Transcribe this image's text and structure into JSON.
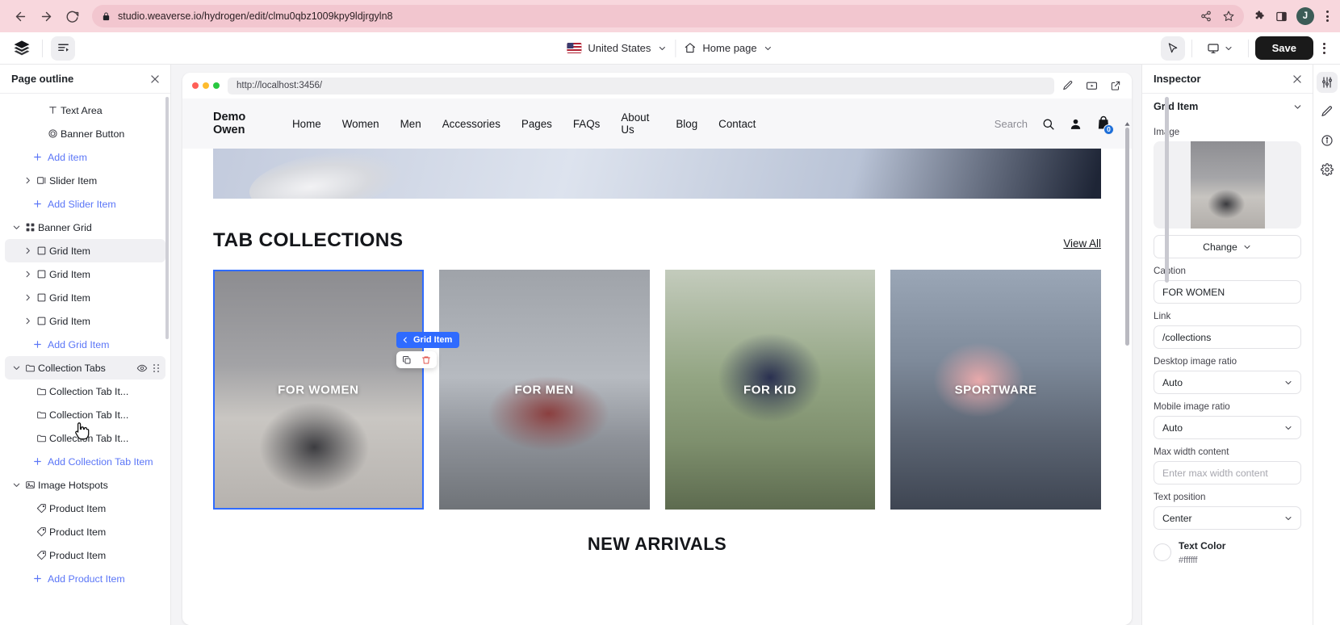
{
  "browser": {
    "url": "studio.weaverse.io/hydrogen/edit/clmu0qbz1009kpy9ldjrgyln8",
    "back_icon": "back-arrow-icon",
    "forward_icon": "forward-arrow-icon",
    "reload_icon": "reload-icon",
    "lock_icon": "lock-icon",
    "share_icon": "share-icon",
    "bookmark_icon": "star-icon",
    "extensions_icon": "puzzle-icon",
    "sidepanel_icon": "side-panel-icon",
    "profile_initial": "J",
    "menu_icon": "kebab-menu-icon"
  },
  "toolbar": {
    "logo_icon": "weaverse-logo-icon",
    "outline_toggle_icon": "page-outline-toggle-icon",
    "market": "United States",
    "page": "Home page",
    "home_icon": "home-icon",
    "chevron_icon": "chevron-down-icon",
    "cursor_tool_icon": "cursor-select-icon",
    "device_icon": "desktop-screen-icon",
    "save_label": "Save",
    "more_icon": "kebab-menu-icon"
  },
  "outline": {
    "title": "Page outline",
    "close_icon": "close-icon",
    "items": [
      {
        "label": "Text Area",
        "icon": "text-icon",
        "indent": 2,
        "caret": "none",
        "type": "item"
      },
      {
        "label": "Banner Button",
        "icon": "circle-target-icon",
        "indent": 2,
        "caret": "none",
        "type": "item"
      },
      {
        "label": "Add item",
        "icon": "plus-icon",
        "indent": 2,
        "caret": "none",
        "type": "add"
      },
      {
        "label": "Slider Item",
        "icon": "slider-item-icon",
        "indent": 1,
        "caret": "right",
        "type": "item"
      },
      {
        "label": "Add Slider Item",
        "icon": "plus-icon",
        "indent": 2,
        "caret": "none",
        "type": "add"
      },
      {
        "label": "Banner Grid",
        "icon": "grid-icon",
        "indent": 0,
        "caret": "down",
        "type": "item"
      },
      {
        "label": "Grid Item",
        "icon": "square-icon",
        "indent": 1,
        "caret": "right",
        "type": "item",
        "selected": true
      },
      {
        "label": "Grid Item",
        "icon": "square-icon",
        "indent": 1,
        "caret": "right",
        "type": "item"
      },
      {
        "label": "Grid Item",
        "icon": "square-icon",
        "indent": 1,
        "caret": "right",
        "type": "item"
      },
      {
        "label": "Grid Item",
        "icon": "square-icon",
        "indent": 1,
        "caret": "right",
        "type": "item"
      },
      {
        "label": "Add Grid Item",
        "icon": "plus-icon",
        "indent": 2,
        "caret": "none",
        "type": "add"
      },
      {
        "label": "Collection Tabs",
        "icon": "folder-icon",
        "indent": 0,
        "caret": "down",
        "type": "item",
        "hovered": true,
        "actions": [
          "eye-icon",
          "drag-handle-icon"
        ]
      },
      {
        "label": "Collection Tab It...",
        "icon": "folder-icon",
        "indent": 1,
        "caret": "none",
        "type": "item"
      },
      {
        "label": "Collection Tab It...",
        "icon": "folder-icon",
        "indent": 1,
        "caret": "none",
        "type": "item"
      },
      {
        "label": "Collection Tab It...",
        "icon": "folder-icon",
        "indent": 1,
        "caret": "none",
        "type": "item"
      },
      {
        "label": "Add Collection Tab Item",
        "icon": "plus-icon",
        "indent": 2,
        "caret": "none",
        "type": "add"
      },
      {
        "label": "Image Hotspots",
        "icon": "image-icon",
        "indent": 0,
        "caret": "down",
        "type": "item"
      },
      {
        "label": "Product Item",
        "icon": "tag-icon",
        "indent": 1,
        "caret": "none",
        "type": "item"
      },
      {
        "label": "Product Item",
        "icon": "tag-icon",
        "indent": 1,
        "caret": "none",
        "type": "item"
      },
      {
        "label": "Product Item",
        "icon": "tag-icon",
        "indent": 1,
        "caret": "none",
        "type": "item"
      },
      {
        "label": "Add Product Item",
        "icon": "plus-icon",
        "indent": 2,
        "caret": "none",
        "type": "add"
      }
    ]
  },
  "preview": {
    "url": "http://localhost:3456/",
    "edit_icon": "pencil-icon",
    "device_icon": "screen-play-icon",
    "open_external_icon": "external-link-icon",
    "site": {
      "logo_line1": "Demo",
      "logo_line2": "Owen",
      "nav": [
        "Home",
        "Women",
        "Men",
        "Accessories",
        "Pages",
        "FAQs",
        "About Us",
        "Blog",
        "Contact"
      ],
      "search_placeholder": "Search",
      "search_icon": "search-icon",
      "account_icon": "user-icon",
      "cart_icon": "cart-icon",
      "cart_count": "0"
    },
    "section": {
      "title": "TAB COLLECTIONS",
      "view_all": "View All",
      "cards": [
        {
          "caption": "FOR WOMEN",
          "selected": true
        },
        {
          "caption": "FOR MEN",
          "selected": false
        },
        {
          "caption": "FOR KID",
          "selected": false
        },
        {
          "caption": "SPORTWARE",
          "selected": false
        }
      ],
      "next_section_title": "NEW ARRIVALS"
    },
    "selection": {
      "badge_label": "Grid Item",
      "badge_back_icon": "chevron-left-icon",
      "badge_color": "#2f6bff",
      "duplicate_icon": "duplicate-icon",
      "delete_icon": "trash-icon"
    }
  },
  "inspector": {
    "title": "Inspector",
    "close_icon": "close-icon",
    "section_title": "Grid Item",
    "section_chevron_icon": "chevron-down-icon",
    "image_label": "Image",
    "change_label": "Change",
    "change_chevron_icon": "chevron-down-icon",
    "caption_label": "Caption",
    "caption_value": "FOR WOMEN",
    "link_label": "Link",
    "link_value": "/collections",
    "desktop_ratio_label": "Desktop image ratio",
    "desktop_ratio_value": "Auto",
    "mobile_ratio_label": "Mobile image ratio",
    "mobile_ratio_value": "Auto",
    "max_width_label": "Max width content",
    "max_width_placeholder": "Enter max width content",
    "max_width_value": "",
    "text_position_label": "Text position",
    "text_position_value": "Center",
    "text_color_label": "Text Color",
    "text_color_value": "#ffffff"
  },
  "rail": {
    "items": [
      {
        "icon": "sliders-settings-icon",
        "active": true
      },
      {
        "icon": "pen-design-icon",
        "active": false
      },
      {
        "icon": "info-icon",
        "active": false
      },
      {
        "icon": "gear-icon",
        "active": false
      }
    ]
  }
}
